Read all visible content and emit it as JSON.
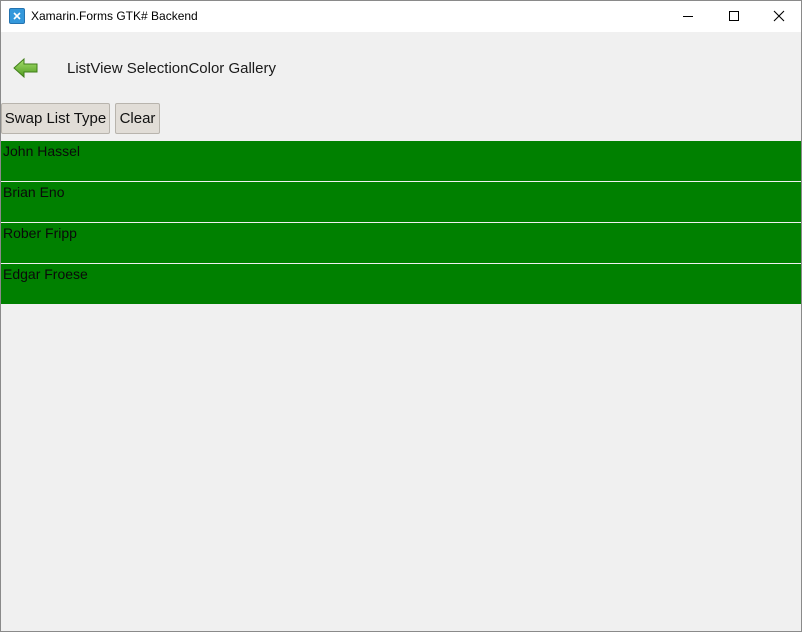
{
  "window": {
    "title": "Xamarin.Forms GTK# Backend",
    "icon": "xamarin-icon",
    "controls": [
      "minimize-icon",
      "maximize-icon",
      "close-icon"
    ]
  },
  "header": {
    "back_icon": "back-arrow-icon",
    "page_title": "ListView SelectionColor Gallery"
  },
  "toolbar": {
    "swap_label": "Swap List Type",
    "clear_label": "Clear"
  },
  "list": {
    "selection_color": "#008000",
    "items": [
      {
        "label": "John Hassel"
      },
      {
        "label": "Brian Eno"
      },
      {
        "label": "Rober Fripp"
      },
      {
        "label": "Edgar Froese"
      }
    ]
  },
  "colors": {
    "background": "#f0f0f0",
    "titlebar": "#ffffff",
    "button_face": "#e1ddd7",
    "accent_icon": "#3498db",
    "back_arrow": "#7ac13a"
  }
}
